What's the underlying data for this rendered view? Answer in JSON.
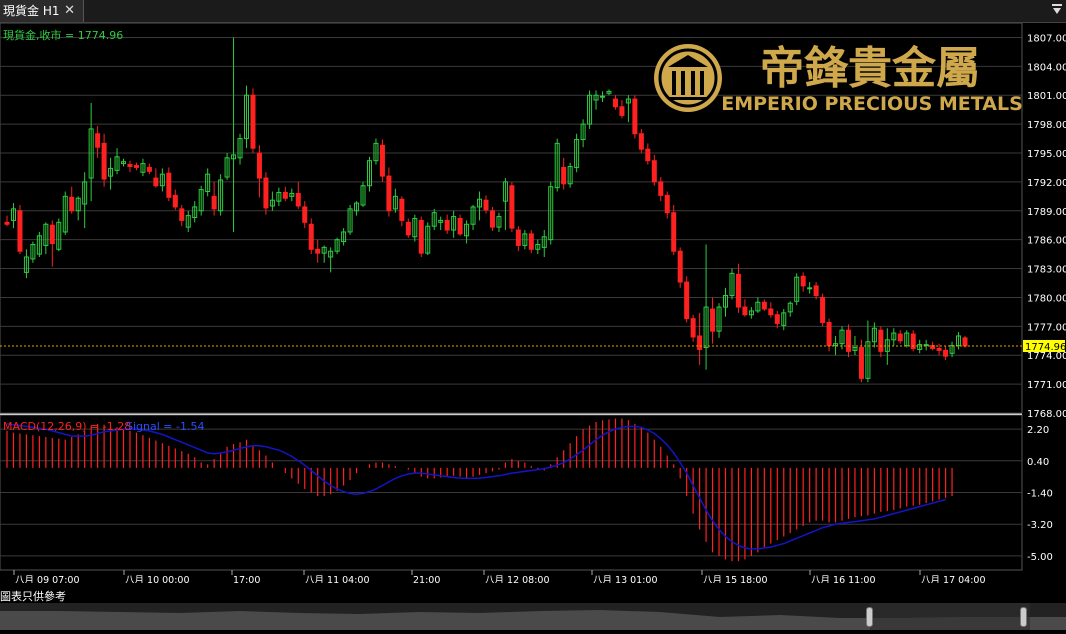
{
  "tab": {
    "title": "現貨金 H1",
    "close_icon": "close-icon"
  },
  "price_label": "現貨金,收市 = 1774.96",
  "logo": {
    "chinese": "帝鋒貴金屬",
    "english": "EMPERIO PRECIOUS METALS"
  },
  "macd_label": {
    "main": "MACD(12,26,9) = -1.28",
    "signal": "Signal = -1.54"
  },
  "footer_note": "圖表只供參考",
  "colors": {
    "up": "#2ecc40",
    "down": "#ff2020",
    "grid": "#3a3a3a",
    "signal": "#1414c8",
    "price_line": "#e8a000",
    "price_tag": "#ffff00"
  },
  "chart_data": {
    "type": "candlestick",
    "symbol": "現貨金",
    "timeframe": "H1",
    "last_price": 1774.96,
    "price_axis": {
      "ticks": [
        "1807.00",
        "1804.00",
        "1801.00",
        "1798.00",
        "1795.00",
        "1792.00",
        "1789.00",
        "1786.00",
        "1783.00",
        "1780.00",
        "1777.00",
        "1774.00",
        "1771.00",
        "1768.00"
      ],
      "range": [
        1768,
        1808.5
      ]
    },
    "time_axis": {
      "labels": [
        "八月 09 07:00",
        "八月 10 00:00",
        "17:00",
        "八月 11 04:00",
        "21:00",
        "八月 12 08:00",
        "八月 13 01:00",
        "八月 15 18:00",
        "八月 16 11:00",
        "八月 17 04:00"
      ]
    },
    "candles_ohlc": [
      [
        1787.8,
        1788.5,
        1787.4,
        1787.6
      ],
      [
        1788.0,
        1789.8,
        1787.2,
        1789.2
      ],
      [
        1789.0,
        1789.6,
        1784.5,
        1784.8
      ],
      [
        1782.6,
        1785.0,
        1782.0,
        1784.2
      ],
      [
        1784.0,
        1785.8,
        1783.6,
        1785.5
      ],
      [
        1784.5,
        1786.8,
        1784.2,
        1786.4
      ],
      [
        1785.4,
        1787.8,
        1784.5,
        1787.6
      ],
      [
        1787.5,
        1788.0,
        1783.2,
        1785.6
      ],
      [
        1785.0,
        1788.2,
        1784.8,
        1787.8
      ],
      [
        1786.8,
        1791.0,
        1786.5,
        1790.5
      ],
      [
        1790.4,
        1791.5,
        1788.7,
        1789.0
      ],
      [
        1789.0,
        1790.5,
        1788.0,
        1790.3
      ],
      [
        1789.7,
        1793.0,
        1787.2,
        1792.0
      ],
      [
        1792.4,
        1800.2,
        1790.0,
        1797.5
      ],
      [
        1797.0,
        1797.8,
        1794.5,
        1795.6
      ],
      [
        1796.0,
        1797.0,
        1791.5,
        1792.3
      ],
      [
        1792.6,
        1794.5,
        1791.2,
        1793.4
      ],
      [
        1793.2,
        1795.5,
        1792.8,
        1794.6
      ],
      [
        1793.9,
        1794.4,
        1793.6,
        1794.1
      ],
      [
        1793.8,
        1794.2,
        1793.0,
        1793.6
      ],
      [
        1793.7,
        1794.0,
        1793.2,
        1793.5
      ],
      [
        1793.0,
        1794.4,
        1792.6,
        1793.9
      ],
      [
        1793.5,
        1793.9,
        1792.8,
        1793.1
      ],
      [
        1792.4,
        1793.4,
        1791.4,
        1791.6
      ],
      [
        1791.6,
        1793.4,
        1791.0,
        1792.8
      ],
      [
        1792.9,
        1793.5,
        1790.0,
        1790.4
      ],
      [
        1790.6,
        1791.2,
        1789.1,
        1789.4
      ],
      [
        1789.2,
        1789.6,
        1787.4,
        1788.0
      ],
      [
        1787.3,
        1789.0,
        1786.8,
        1788.5
      ],
      [
        1788.3,
        1790.0,
        1787.8,
        1789.4
      ],
      [
        1789.0,
        1791.6,
        1788.5,
        1791.2
      ],
      [
        1791.0,
        1793.4,
        1790.5,
        1792.8
      ],
      [
        1790.5,
        1792.0,
        1788.5,
        1789.2
      ],
      [
        1789.0,
        1792.8,
        1788.5,
        1792.2
      ],
      [
        1792.5,
        1795.0,
        1792.2,
        1794.5
      ],
      [
        1794.4,
        1807.0,
        1786.8,
        1794.8
      ],
      [
        1794.5,
        1797.0,
        1793.8,
        1796.5
      ],
      [
        1796.5,
        1802.0,
        1795.5,
        1801.0
      ],
      [
        1801.0,
        1801.7,
        1795.0,
        1795.5
      ],
      [
        1795.0,
        1795.8,
        1790.4,
        1792.4
      ],
      [
        1792.4,
        1793.0,
        1788.6,
        1789.3
      ],
      [
        1789.5,
        1791.0,
        1789.0,
        1790.1
      ],
      [
        1790.0,
        1791.4,
        1789.5,
        1790.9
      ],
      [
        1790.9,
        1791.5,
        1790.0,
        1790.3
      ],
      [
        1790.5,
        1791.3,
        1790.0,
        1790.8
      ],
      [
        1790.8,
        1792.0,
        1789.2,
        1789.5
      ],
      [
        1789.4,
        1790.0,
        1787.2,
        1787.8
      ],
      [
        1787.6,
        1788.2,
        1784.5,
        1785.0
      ],
      [
        1785.0,
        1786.0,
        1783.6,
        1784.6
      ],
      [
        1784.6,
        1785.4,
        1783.6,
        1785.2
      ],
      [
        1784.2,
        1785.2,
        1782.6,
        1784.8
      ],
      [
        1784.8,
        1786.2,
        1784.5,
        1786.0
      ],
      [
        1785.8,
        1787.2,
        1785.4,
        1786.8
      ],
      [
        1786.8,
        1789.6,
        1786.5,
        1789.2
      ],
      [
        1789.0,
        1790.0,
        1788.5,
        1789.8
      ],
      [
        1789.6,
        1792.0,
        1789.4,
        1791.6
      ],
      [
        1791.6,
        1794.6,
        1791.0,
        1794.2
      ],
      [
        1794.2,
        1796.5,
        1793.8,
        1796.0
      ],
      [
        1795.8,
        1796.4,
        1792.0,
        1792.6
      ],
      [
        1792.6,
        1793.5,
        1788.4,
        1789.0
      ],
      [
        1789.2,
        1791.3,
        1788.8,
        1790.5
      ],
      [
        1790.2,
        1790.5,
        1787.4,
        1788.0
      ],
      [
        1787.8,
        1788.2,
        1786.2,
        1786.5
      ],
      [
        1786.3,
        1788.6,
        1785.8,
        1788.2
      ],
      [
        1788.0,
        1788.4,
        1784.2,
        1784.6
      ],
      [
        1784.6,
        1787.8,
        1784.4,
        1787.4
      ],
      [
        1787.4,
        1789.2,
        1787.0,
        1788.8
      ],
      [
        1787.8,
        1788.4,
        1787.0,
        1788.0
      ],
      [
        1788.0,
        1788.6,
        1786.6,
        1787.0
      ],
      [
        1787.0,
        1789.0,
        1786.2,
        1788.4
      ],
      [
        1788.2,
        1788.6,
        1786.4,
        1786.6
      ],
      [
        1786.4,
        1788.0,
        1785.6,
        1787.6
      ],
      [
        1787.6,
        1789.6,
        1787.0,
        1789.4
      ],
      [
        1789.4,
        1791.0,
        1788.0,
        1790.2
      ],
      [
        1790.1,
        1790.6,
        1788.7,
        1789.1
      ],
      [
        1789.0,
        1789.4,
        1786.9,
        1787.3
      ],
      [
        1787.3,
        1788.8,
        1786.8,
        1788.4
      ],
      [
        1790.0,
        1792.4,
        1787.0,
        1792.0
      ],
      [
        1791.6,
        1792.0,
        1786.8,
        1787.2
      ],
      [
        1787.0,
        1787.4,
        1784.8,
        1785.4
      ],
      [
        1785.4,
        1787.0,
        1785.0,
        1786.6
      ],
      [
        1786.6,
        1787.0,
        1784.6,
        1785.0
      ],
      [
        1785.0,
        1786.0,
        1784.5,
        1785.5
      ],
      [
        1785.2,
        1787.0,
        1784.2,
        1786.3
      ],
      [
        1786.0,
        1792.0,
        1785.5,
        1791.5
      ],
      [
        1791.4,
        1796.5,
        1791.0,
        1796.0
      ],
      [
        1793.5,
        1794.5,
        1791.2,
        1791.8
      ],
      [
        1791.8,
        1794.0,
        1791.4,
        1793.6
      ],
      [
        1793.5,
        1797.0,
        1793.0,
        1796.4
      ],
      [
        1796.4,
        1798.5,
        1795.6,
        1798.0
      ],
      [
        1798.0,
        1801.5,
        1797.5,
        1801.0
      ],
      [
        1800.5,
        1801.5,
        1799.5,
        1801.0
      ],
      [
        1800.8,
        1801.4,
        1800.3,
        1800.9
      ],
      [
        1801.2,
        1801.6,
        1801.0,
        1801.4
      ],
      [
        1800.6,
        1801.0,
        1799.5,
        1799.8
      ],
      [
        1799.8,
        1800.5,
        1798.6,
        1798.9
      ],
      [
        1800.2,
        1801.0,
        1798.2,
        1800.6
      ],
      [
        1800.6,
        1801.0,
        1796.5,
        1797.0
      ],
      [
        1797.0,
        1797.5,
        1795.0,
        1795.4
      ],
      [
        1795.4,
        1796.0,
        1793.8,
        1794.2
      ],
      [
        1794.2,
        1794.8,
        1791.6,
        1792.0
      ],
      [
        1792.0,
        1792.5,
        1790.0,
        1790.6
      ],
      [
        1790.6,
        1791.0,
        1788.2,
        1788.8
      ],
      [
        1788.8,
        1789.6,
        1784.4,
        1784.8
      ],
      [
        1784.8,
        1785.2,
        1781.0,
        1781.6
      ],
      [
        1781.6,
        1782.2,
        1777.4,
        1777.8
      ],
      [
        1777.8,
        1778.2,
        1775.4,
        1775.9
      ],
      [
        1776.0,
        1778.4,
        1773.0,
        1774.6
      ],
      [
        1774.8,
        1785.5,
        1772.5,
        1779.0
      ],
      [
        1778.8,
        1780.0,
        1775.2,
        1776.5
      ],
      [
        1776.5,
        1779.4,
        1775.8,
        1779.0
      ],
      [
        1779.0,
        1781.0,
        1778.0,
        1780.2
      ],
      [
        1780.2,
        1783.0,
        1779.8,
        1782.5
      ],
      [
        1782.4,
        1783.5,
        1778.4,
        1779.0
      ],
      [
        1779.0,
        1779.8,
        1778.0,
        1778.2
      ],
      [
        1778.2,
        1779.0,
        1777.8,
        1778.6
      ],
      [
        1778.6,
        1780.0,
        1778.4,
        1779.5
      ],
      [
        1779.5,
        1779.8,
        1778.6,
        1778.8
      ],
      [
        1778.8,
        1779.5,
        1777.9,
        1778.2
      ],
      [
        1778.2,
        1778.6,
        1776.8,
        1777.3
      ],
      [
        1777.1,
        1778.8,
        1776.6,
        1778.4
      ],
      [
        1778.5,
        1779.6,
        1778.0,
        1779.4
      ],
      [
        1779.6,
        1782.5,
        1779.2,
        1782.1
      ],
      [
        1782.2,
        1782.6,
        1780.6,
        1781.2
      ],
      [
        1781.0,
        1781.6,
        1780.4,
        1781.0
      ],
      [
        1781.2,
        1781.6,
        1779.8,
        1780.2
      ],
      [
        1780.0,
        1780.4,
        1777.0,
        1777.4
      ],
      [
        1777.4,
        1777.8,
        1774.4,
        1775.0
      ],
      [
        1775.0,
        1776.0,
        1774.0,
        1775.2
      ],
      [
        1775.2,
        1777.0,
        1774.6,
        1776.6
      ],
      [
        1776.6,
        1777.2,
        1773.8,
        1774.4
      ],
      [
        1774.5,
        1776.0,
        1774.0,
        1774.8
      ],
      [
        1774.8,
        1775.6,
        1771.2,
        1771.6
      ],
      [
        1771.6,
        1777.6,
        1771.2,
        1775.4
      ],
      [
        1775.4,
        1777.4,
        1774.8,
        1776.8
      ],
      [
        1776.6,
        1777.0,
        1773.8,
        1774.4
      ],
      [
        1774.4,
        1776.8,
        1773.0,
        1775.6
      ],
      [
        1775.6,
        1776.8,
        1775.0,
        1776.3
      ],
      [
        1776.2,
        1776.6,
        1775.2,
        1775.5
      ],
      [
        1775.0,
        1776.6,
        1774.8,
        1776.3
      ],
      [
        1776.2,
        1776.6,
        1774.4,
        1774.7
      ],
      [
        1774.6,
        1775.6,
        1774.2,
        1775.1
      ],
      [
        1775.1,
        1775.6,
        1774.5,
        1775.1
      ],
      [
        1775.0,
        1775.4,
        1774.5,
        1774.7
      ],
      [
        1774.7,
        1775.2,
        1774.0,
        1774.5
      ],
      [
        1774.5,
        1775.0,
        1773.5,
        1773.9
      ],
      [
        1774.2,
        1775.4,
        1773.8,
        1775.0
      ],
      [
        1775.0,
        1776.4,
        1774.6,
        1776.0
      ],
      [
        1775.8,
        1776.0,
        1774.8,
        1774.96
      ]
    ],
    "macd_axis": {
      "ticks": [
        "2.20",
        "0.40",
        "-1.40",
        "-3.20",
        "-5.00"
      ],
      "range": [
        -5.8,
        3.0
      ]
    },
    "macd_histogram": [
      2.1,
      2.0,
      1.95,
      1.9,
      1.85,
      1.8,
      1.75,
      1.7,
      1.65,
      1.6,
      1.75,
      1.9,
      2.1,
      2.4,
      2.5,
      2.45,
      2.4,
      2.3,
      2.2,
      2.1,
      2.0,
      1.85,
      1.7,
      1.55,
      1.4,
      1.25,
      1.1,
      0.95,
      0.8,
      0.6,
      0.3,
      0.2,
      0.5,
      0.8,
      1.2,
      1.35,
      1.45,
      1.6,
      1.3,
      1.0,
      0.7,
      0.3,
      0.0,
      -0.3,
      -0.6,
      -0.9,
      -1.2,
      -1.4,
      -1.6,
      -1.6,
      -1.5,
      -1.3,
      -1.0,
      -0.7,
      -0.3,
      0.0,
      0.2,
      0.3,
      0.3,
      0.2,
      0.1,
      0.0,
      -0.1,
      -0.3,
      -0.5,
      -0.6,
      -0.6,
      -0.55,
      -0.5,
      -0.45,
      -0.5,
      -0.6,
      -0.5,
      -0.4,
      -0.3,
      -0.2,
      -0.1,
      0.3,
      0.5,
      0.4,
      0.3,
      0.1,
      -0.1,
      -0.15,
      0.2,
      0.6,
      1.0,
      1.4,
      1.8,
      2.2,
      2.4,
      2.6,
      2.7,
      2.75,
      2.8,
      2.8,
      2.7,
      2.5,
      2.3,
      2.0,
      1.6,
      1.2,
      0.7,
      0.2,
      -0.6,
      -1.6,
      -2.6,
      -3.5,
      -4.2,
      -4.8,
      -5.0,
      -5.2,
      -5.3,
      -5.3,
      -5.2,
      -5.0,
      -4.8,
      -4.5,
      -4.3,
      -4.1,
      -3.9,
      -3.7,
      -3.5,
      -3.3,
      -3.1,
      -3.0,
      -3.0,
      -3.1,
      -3.1,
      -3.0,
      -2.9,
      -2.8,
      -2.75,
      -2.7,
      -2.6,
      -2.5,
      -2.45,
      -2.4,
      -2.3,
      -2.2,
      -2.15,
      -2.1,
      -2.0,
      -1.9,
      -1.8,
      -1.7,
      -1.6
    ],
    "macd_signal": [
      2.5,
      2.45,
      2.4,
      2.35,
      2.3,
      2.25,
      2.2,
      2.1,
      2.0,
      1.9,
      1.8,
      1.8,
      1.8,
      1.85,
      1.95,
      2.05,
      2.1,
      2.15,
      2.2,
      2.2,
      2.2,
      2.15,
      2.1,
      2.0,
      1.9,
      1.75,
      1.6,
      1.45,
      1.3,
      1.15,
      1.0,
      0.85,
      0.8,
      0.85,
      0.9,
      1.0,
      1.1,
      1.2,
      1.25,
      1.25,
      1.2,
      1.1,
      1.0,
      0.85,
      0.65,
      0.4,
      0.15,
      -0.15,
      -0.45,
      -0.75,
      -1.0,
      -1.2,
      -1.35,
      -1.45,
      -1.5,
      -1.45,
      -1.35,
      -1.2,
      -1.0,
      -0.8,
      -0.6,
      -0.45,
      -0.35,
      -0.3,
      -0.3,
      -0.35,
      -0.4,
      -0.45,
      -0.5,
      -0.55,
      -0.58,
      -0.6,
      -0.6,
      -0.58,
      -0.55,
      -0.5,
      -0.45,
      -0.38,
      -0.3,
      -0.25,
      -0.2,
      -0.15,
      -0.1,
      -0.05,
      0.05,
      0.15,
      0.3,
      0.5,
      0.75,
      1.0,
      1.3,
      1.6,
      1.85,
      2.05,
      2.2,
      2.3,
      2.35,
      2.35,
      2.3,
      2.15,
      1.95,
      1.65,
      1.3,
      0.85,
      0.3,
      -0.3,
      -1.0,
      -1.7,
      -2.4,
      -3.0,
      -3.5,
      -3.9,
      -4.2,
      -4.4,
      -4.55,
      -4.6,
      -4.6,
      -4.55,
      -4.5,
      -4.4,
      -4.3,
      -4.15,
      -4.0,
      -3.85,
      -3.7,
      -3.55,
      -3.4,
      -3.3,
      -3.2,
      -3.15,
      -3.1,
      -3.05,
      -3.0,
      -2.95,
      -2.9,
      -2.8,
      -2.7,
      -2.6,
      -2.5,
      -2.4,
      -2.3,
      -2.2,
      -2.1,
      -2.0,
      -1.9,
      -1.8
    ]
  }
}
